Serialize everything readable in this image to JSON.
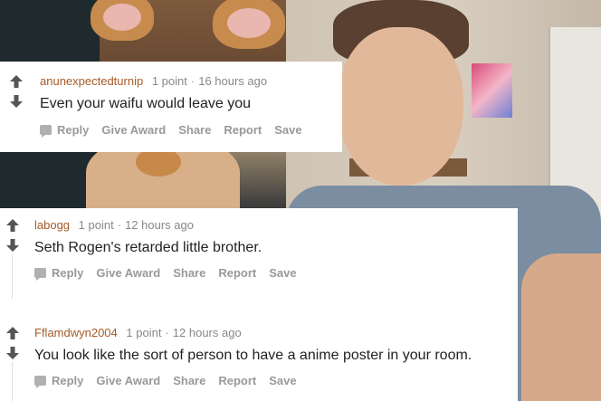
{
  "colors": {
    "author": "#a55a27",
    "meta": "#888888",
    "action": "#999999",
    "arrow": "#555555"
  },
  "comments": [
    {
      "author": "anunexpectedturnip",
      "points": "1 point",
      "time": "16 hours ago",
      "text": "Even your waifu would leave you",
      "actions": [
        "Reply",
        "Give Award",
        "Share",
        "Report",
        "Save"
      ]
    },
    {
      "author": "labogg",
      "points": "1 point",
      "time": "12 hours ago",
      "text": "Seth Rogen's retarded little brother.",
      "actions": [
        "Reply",
        "Give Award",
        "Share",
        "Report",
        "Save"
      ]
    },
    {
      "author": "Fflamdwyn2004",
      "points": "1 point",
      "time": "12 hours ago",
      "text": "You look like the sort of person to have a anime poster in your room.",
      "actions": [
        "Reply",
        "Give Award",
        "Share",
        "Report",
        "Save"
      ]
    }
  ]
}
